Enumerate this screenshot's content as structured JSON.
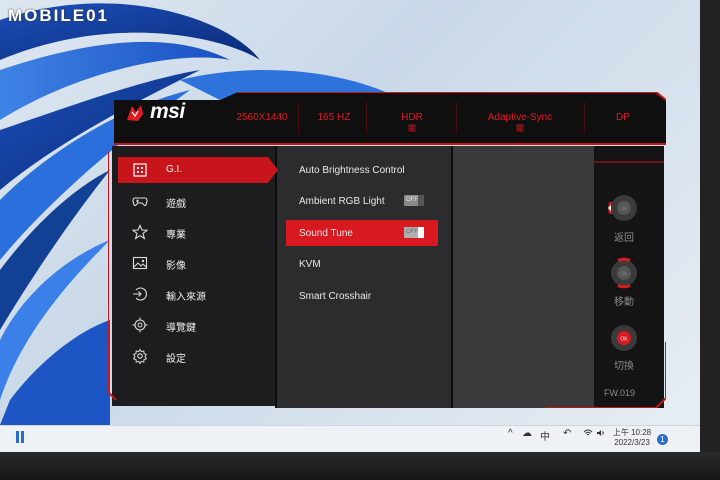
{
  "watermark": "MOBILE01",
  "osd": {
    "brand": "msi",
    "header": [
      {
        "label": "2560X1440",
        "sub": ""
      },
      {
        "label": "165 HZ",
        "sub": ""
      },
      {
        "label": "HDR",
        "sub": "關"
      },
      {
        "label": "Adaptive-Sync",
        "sub": "關"
      },
      {
        "label": "DP",
        "sub": ""
      }
    ],
    "sidebar": [
      {
        "label": "G.I.",
        "icon": "gaming-intelligence-icon",
        "active": true
      },
      {
        "label": "遊戲",
        "icon": "gamepad-icon",
        "active": false
      },
      {
        "label": "專業",
        "icon": "star-icon",
        "active": false
      },
      {
        "label": "影像",
        "icon": "image-icon",
        "active": false
      },
      {
        "label": "輸入來源",
        "icon": "input-source-icon",
        "active": false
      },
      {
        "label": "導覽鍵",
        "icon": "navigation-key-icon",
        "active": false
      },
      {
        "label": "設定",
        "icon": "gear-icon",
        "active": false
      }
    ],
    "menu": [
      {
        "label": "Auto Brightness Control",
        "toggle": "",
        "active": false
      },
      {
        "label": "Ambient RGB Light",
        "toggle": "OFF",
        "active": false
      },
      {
        "label": "Sound Tune",
        "toggle": "OFF",
        "active": true
      },
      {
        "label": "KVM",
        "toggle": "",
        "active": false
      },
      {
        "label": "Smart Crosshair",
        "toggle": "",
        "active": false
      }
    ],
    "nav": {
      "back_label": "返回",
      "move_label": "移動",
      "switch_label": "切換",
      "ok_text": "OK"
    },
    "firmware": "FW.019",
    "accent_color": "#d81920"
  },
  "taskbar": {
    "tray_ime": "中",
    "time": "上午 10:28",
    "date": "2022/3/23",
    "notification_count": "1"
  }
}
